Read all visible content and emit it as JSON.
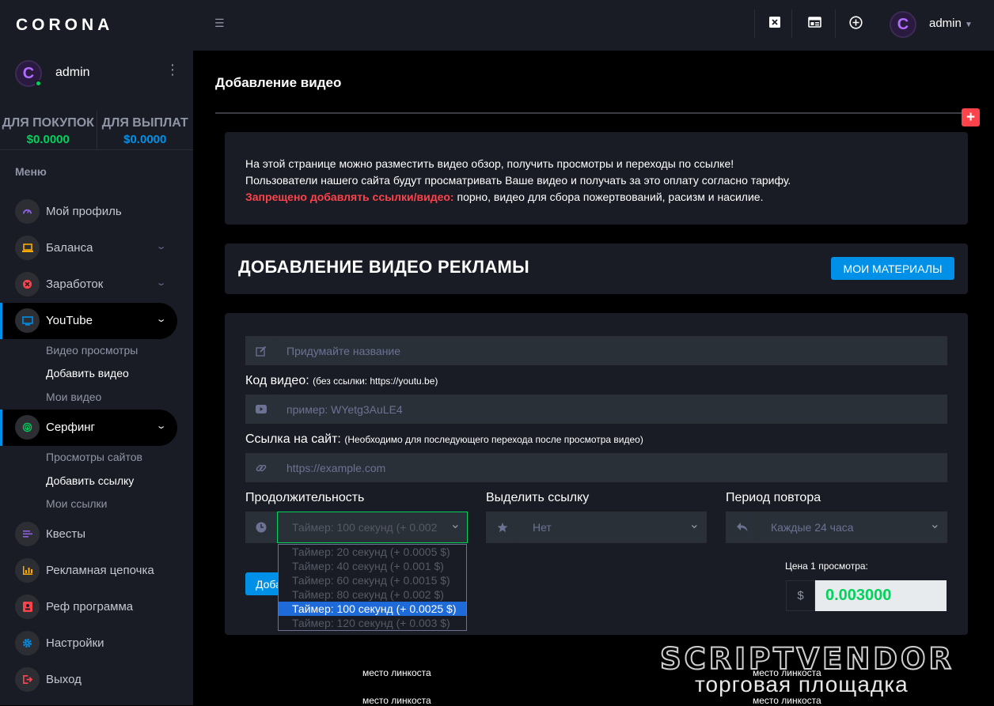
{
  "brand": "CORONA",
  "user": {
    "name": "admin",
    "avatar_letter": "C"
  },
  "balances": [
    {
      "title": "ДЛЯ ПОКУПОК",
      "value": "$0.0000",
      "color": "#00d25b"
    },
    {
      "title": "ДЛЯ ВЫПЛАТ",
      "value": "$0.0000",
      "color": "#0090e7"
    }
  ],
  "menu_label": "Меню",
  "nav": {
    "profile": "Мой профиль",
    "balance": "Баланса",
    "earnings": "Заработок",
    "youtube": "YouTube",
    "youtube_sub": [
      "Видео просмотры",
      "Добавить видео",
      "Мои видео"
    ],
    "surfing": "Серфинг",
    "surfing_sub": [
      "Просмотры сайтов",
      "Добавить ссылку",
      "Мои ссылки"
    ],
    "quests": "Квесты",
    "ad_chain": "Рекламная цепочка",
    "referral": "Реф программа",
    "settings": "Настройки",
    "logout": "Выход"
  },
  "topbar": {
    "user_name": "admin"
  },
  "page_title": "Добавление видео",
  "info": {
    "line1": "На этой странице можно разместить видео обзор, получить просмотры и переходы по ссылке!",
    "line2": "Пользователи нашего сайта будут просматривать Ваше видео и получать за это оплату согласно тарифу.",
    "warn_label": "Запрещено добавлять ссылки/видео:",
    "warn_text": " порно, видео для сбора пожертвований, расизм и насилие."
  },
  "section": {
    "title": "ДОБАВЛЕНИЕ ВИДЕО РЕКЛАМЫ",
    "my_materials": "МОИ МАТЕРИАЛЫ"
  },
  "form": {
    "name_placeholder": "Придумайте название",
    "video_code_label": "Код видео:",
    "video_code_note": "(без ссылки: https://youtu.be)",
    "video_code_placeholder": "пример: WYetg3AuLE4",
    "site_link_label": "Ссылка на сайт:",
    "site_link_note": "(Необходимо для последующего перехода после просмотра видео)",
    "site_link_placeholder": "https://example.com",
    "duration_label": "Продолжительность",
    "duration_value": "Таймер: 100 секунд (+ 0.002",
    "duration_options": [
      "Таймер: 20 секунд (+ 0.0005 $)",
      "Таймер: 40 секунд (+ 0.001 $)",
      "Таймер: 60 секунд (+ 0.0015 $)",
      "Таймер: 80 секунд (+ 0.002 $)",
      "Таймер: 100 секунд (+ 0.0025 $)",
      "Таймер: 120 секунд (+ 0.003 $)"
    ],
    "highlight_label": "Выделить ссылку",
    "highlight_value": "Нет",
    "repeat_label": "Период повтора",
    "repeat_value": "Каждые 24 часа",
    "submit_label": "Добавить",
    "price_label": "Цена 1 просмотра:",
    "price_currency": "$",
    "price_value": "0.003000"
  },
  "link_spots": [
    "место линкоста",
    "место линкоста",
    "место линкоста",
    "место линкоста"
  ],
  "watermark": {
    "logo": "SCRIPTVENDOR",
    "subtitle": "торговая площадка"
  }
}
